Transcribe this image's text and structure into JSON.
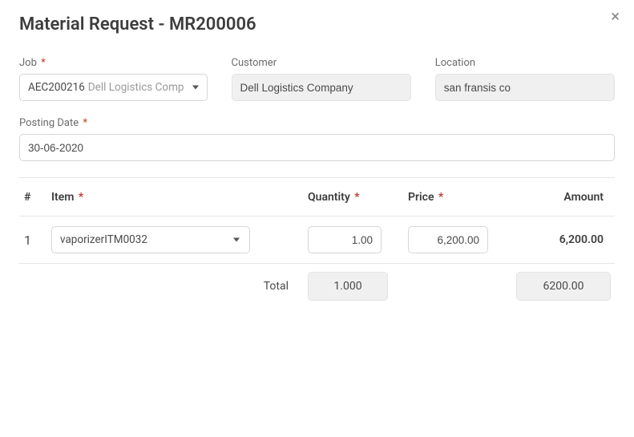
{
  "title": "Material Request - MR200006",
  "fields": {
    "job": {
      "label": "Job",
      "required_mark": "*",
      "selected_main": "AEC200216",
      "selected_sub": "Dell Logistics Comp"
    },
    "customer": {
      "label": "Customer",
      "value": "Dell Logistics Company"
    },
    "location": {
      "label": "Location",
      "value": "san fransis co"
    },
    "posting_date": {
      "label": "Posting Date",
      "required_mark": "*",
      "value": "30-06-2020"
    }
  },
  "table": {
    "headers": {
      "idx": "#",
      "item": "Item",
      "quantity": "Quantity",
      "price": "Price",
      "amount": "Amount",
      "required_mark": "*"
    },
    "rows": [
      {
        "idx": "1",
        "item_name": "vaporizer",
        "item_code": "ITM0032",
        "quantity": "1.00",
        "price": "6,200.00",
        "amount": "6,200.00"
      }
    ],
    "totals": {
      "label": "Total",
      "quantity": "1.000",
      "amount": "6200.00"
    }
  }
}
